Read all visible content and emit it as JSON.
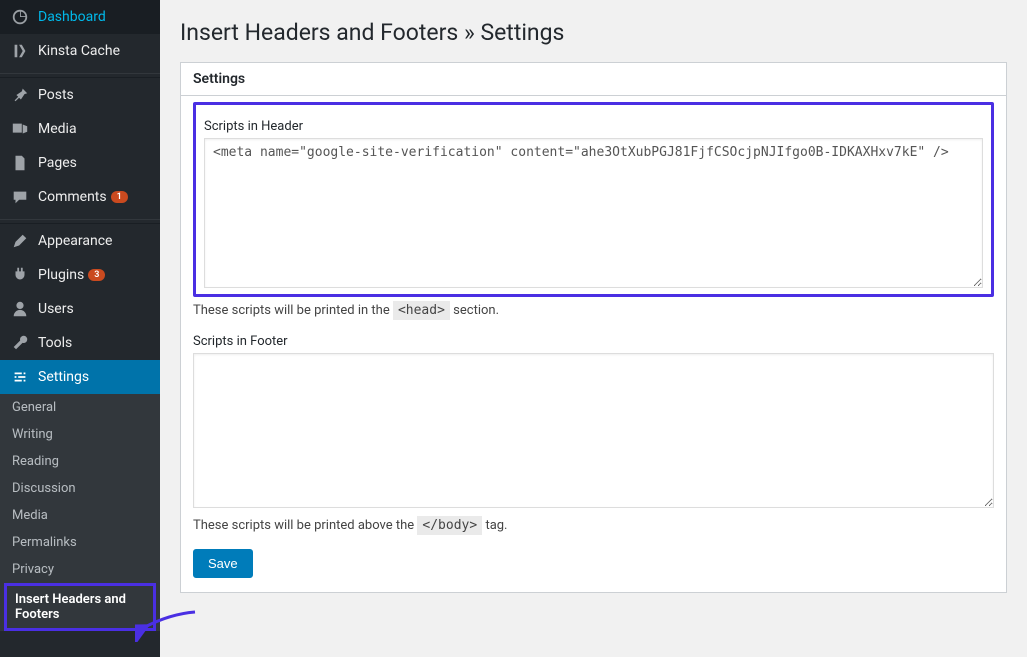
{
  "sidebar": {
    "items": [
      {
        "label": "Dashboard"
      },
      {
        "label": "Kinsta Cache"
      },
      {
        "label": "Posts"
      },
      {
        "label": "Media"
      },
      {
        "label": "Pages"
      },
      {
        "label": "Comments",
        "badge": "1"
      },
      {
        "label": "Appearance"
      },
      {
        "label": "Plugins",
        "badge": "3"
      },
      {
        "label": "Users"
      },
      {
        "label": "Tools"
      },
      {
        "label": "Settings"
      }
    ],
    "submenu": [
      {
        "label": "General"
      },
      {
        "label": "Writing"
      },
      {
        "label": "Reading"
      },
      {
        "label": "Discussion"
      },
      {
        "label": "Media"
      },
      {
        "label": "Permalinks"
      },
      {
        "label": "Privacy"
      },
      {
        "label": "Insert Headers and Footers"
      }
    ]
  },
  "page": {
    "title": "Insert Headers and Footers » Settings",
    "panel_title": "Settings",
    "header_label": "Scripts in Header",
    "header_value": "<meta name=\"google-site-verification\" content=\"ahe3OtXubPGJ81FjfCSOcjpNJIfgo0B-IDKAXHxv7kE\" />",
    "header_help_prefix": "These scripts will be printed in the ",
    "header_help_code": "<head>",
    "header_help_suffix": " section.",
    "footer_label": "Scripts in Footer",
    "footer_value": "",
    "footer_help_prefix": "These scripts will be printed above the ",
    "footer_help_code": "</body>",
    "footer_help_suffix": " tag.",
    "save_label": "Save"
  }
}
